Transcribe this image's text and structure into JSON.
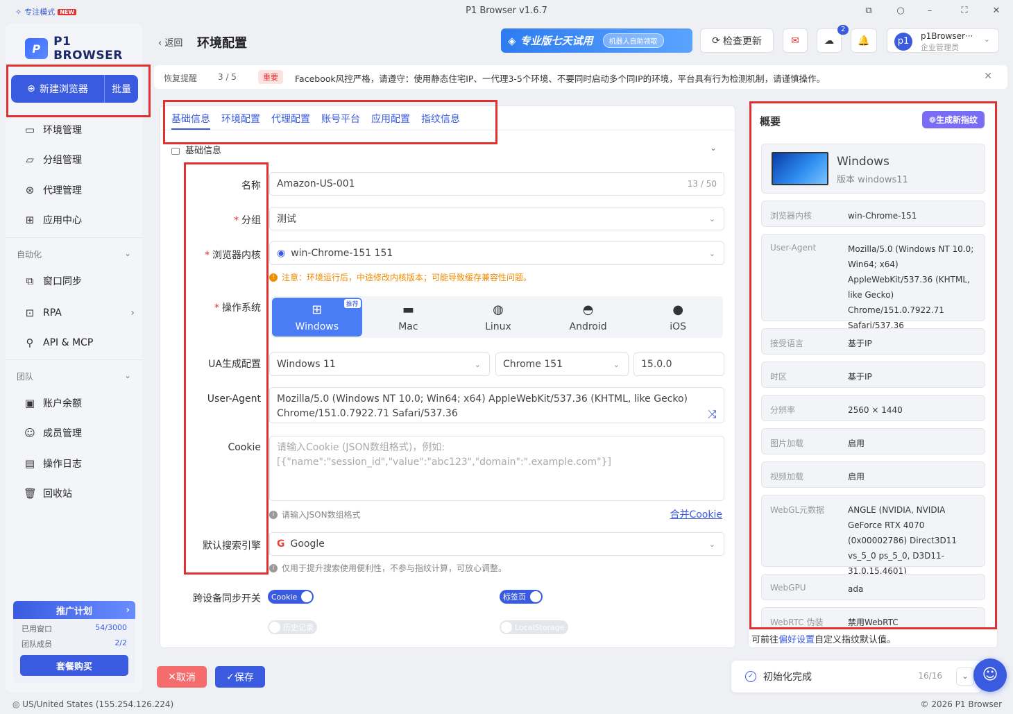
{
  "titlebar": {
    "focus_mode": "专注模式",
    "new_tag": "NEW",
    "title": "P1 Browser v1.6.7"
  },
  "sidebar": {
    "logo": "P1 BROWSER",
    "new_browser": "新建浏览器",
    "batch": "批量",
    "items": [
      {
        "label": "环境管理",
        "icon": "env-icon"
      },
      {
        "label": "分组管理",
        "icon": "folder-icon"
      },
      {
        "label": "代理管理",
        "icon": "proxy-icon"
      },
      {
        "label": "应用中心",
        "icon": "apps-icon"
      }
    ],
    "section_auto": "自动化",
    "auto_items": [
      {
        "label": "窗口同步"
      },
      {
        "label": "RPA"
      },
      {
        "label": "API & MCP"
      }
    ],
    "section_team": "团队",
    "team_items": [
      {
        "label": "账户余额"
      },
      {
        "label": "成员管理"
      },
      {
        "label": "操作日志"
      },
      {
        "label": "回收站"
      }
    ],
    "promo": {
      "title": "推广计划",
      "windows_label": "已用窗口",
      "windows_value": "54/3000",
      "members_label": "团队成员",
      "members_value": "2/2",
      "buy": "套餐购买"
    }
  },
  "topbar": {
    "back": "返回",
    "title": "环境配置",
    "trial": "专业版七天试用",
    "trial_pill": "机器人自助领取",
    "check_update": "检查更新",
    "cloud_badge": "2",
    "user_name": "p1Browser···",
    "user_role": "企业管理员",
    "avatar": "p1"
  },
  "notice": {
    "label": "恢复提醒",
    "page": "3 / 5",
    "tag": "重要",
    "message": "Facebook风控严格，请遵守：使用静态住宅IP、一代理3-5个环境、不要同时启动多个同IP的环境，平台具有行为检测机制，请谨慎操作。"
  },
  "tabs": [
    "基础信息",
    "环境配置",
    "代理配置",
    "账号平台",
    "应用配置",
    "指纹信息"
  ],
  "form": {
    "section": "基础信息",
    "name_label": "名称",
    "name_value": "Amazon-US-001",
    "name_count": "13 / 50",
    "group_label": "分组",
    "group_value": "测试",
    "kernel_label": "浏览器内核",
    "kernel_value": "win-Chrome-151 151",
    "kernel_warn": "注意：环境运行后，中途修改内核版本；可能导致缓存兼容性问题。",
    "os_label": "操作系统",
    "os_options": [
      "Windows",
      "Mac",
      "Linux",
      "Android",
      "iOS"
    ],
    "os_recommend": "推荐",
    "ua_gen_label": "UA生成配置",
    "ua_os": "Windows 11",
    "ua_browser": "Chrome 151",
    "ua_version": "15.0.0",
    "ua_label": "User-Agent",
    "ua_value": "Mozilla/5.0 (Windows NT 10.0; Win64; x64) AppleWebKit/537.36 (KHTML, like Gecko) Chrome/151.0.7922.71 Safari/537.36",
    "cookie_label": "Cookie",
    "cookie_placeholder": "请输入Cookie (JSON数组格式)，例如:\n[{\"name\":\"session_id\",\"value\":\"abc123\",\"domain\":\".example.com\"}]",
    "cookie_hint": "请输入JSON数组格式",
    "merge_cookie": "合并Cookie",
    "search_label": "默认搜索引擎",
    "search_value": "Google",
    "search_hint": "仅用于提升搜索使用便利性，不参与指纹计算，可放心调整。",
    "sync_label": "跨设备同步开关",
    "sync_cookie": "Cookie",
    "sync_tabs": "标签页",
    "sync_history": "历史记录",
    "sync_storage": "LocalStorage"
  },
  "summary": {
    "title": "概要",
    "generate": "生成新指纹",
    "os_name": "Windows",
    "os_version": "版本 windows11",
    "rows": [
      {
        "k": "浏览器内核",
        "v": "win-Chrome-151"
      },
      {
        "k": "User-Agent",
        "v": "Mozilla/5.0 (Windows NT 10.0; Win64; x64) AppleWebKit/537.36 (KHTML, like Gecko) Chrome/151.0.7922.71 Safari/537.36"
      },
      {
        "k": "接受语言",
        "v": "基于IP"
      },
      {
        "k": "时区",
        "v": "基于IP"
      },
      {
        "k": "分辨率",
        "v": "2560 × 1440"
      },
      {
        "k": "图片加载",
        "v": "启用"
      },
      {
        "k": "视频加载",
        "v": "启用"
      },
      {
        "k": "WebGL元数据",
        "v": "ANGLE (NVIDIA, NVIDIA GeForce RTX 4070 (0x00002786) Direct3D11 vs_5_0 ps_5_0, D3D11-31.0.15.4601)"
      },
      {
        "k": "WebGPU",
        "v": "ada"
      },
      {
        "k": "WebRTC 伪装",
        "v": "禁用WebRTC"
      }
    ],
    "footer_pre": "可前往",
    "footer_link": "偏好设置",
    "footer_post": "自定义指纹默认值。"
  },
  "footer": {
    "cancel": "取消",
    "save": "保存",
    "init": "初始化完成",
    "progress": "16/16",
    "status": "US/United States (155.254.126.224)",
    "copyright": "© 2026 P1 Browser"
  },
  "colors": {
    "accent": "#3a5be0",
    "danger": "#e03131"
  }
}
